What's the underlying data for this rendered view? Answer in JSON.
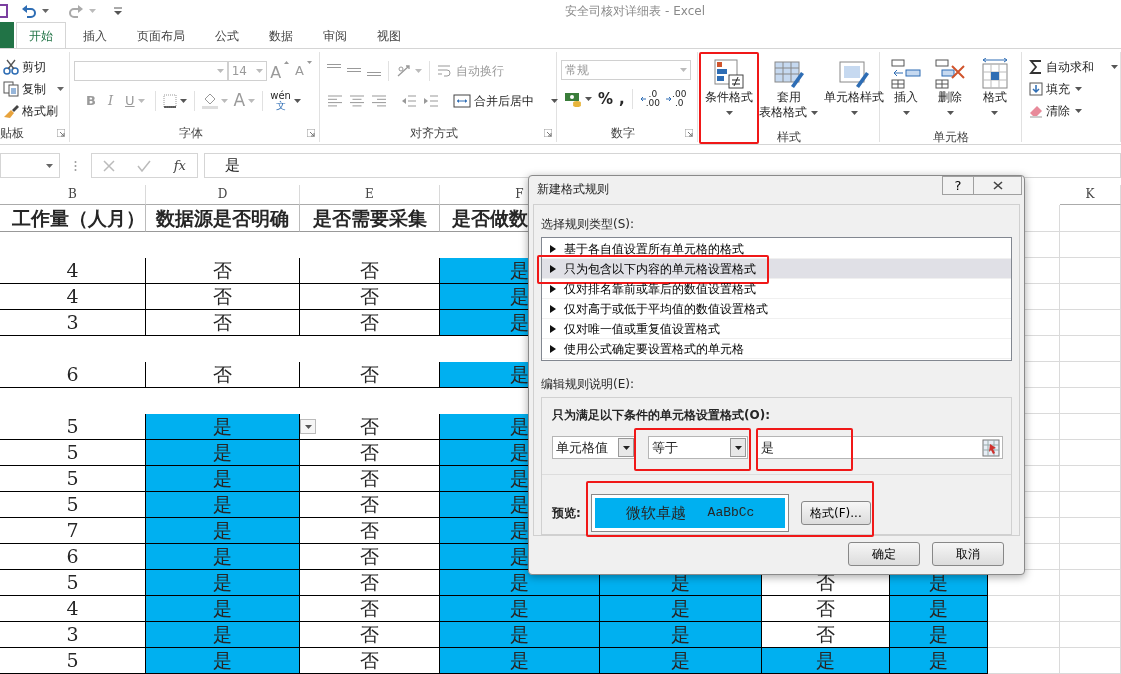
{
  "window": {
    "title": "安全司核对详细表 - Excel"
  },
  "tabs": [
    {
      "label": "开始",
      "selected": true
    },
    {
      "label": "插入",
      "selected": false
    },
    {
      "label": "页面布局",
      "selected": false
    },
    {
      "label": "公式",
      "selected": false
    },
    {
      "label": "数据",
      "selected": false
    },
    {
      "label": "审阅",
      "selected": false
    },
    {
      "label": "视图",
      "selected": false
    }
  ],
  "ribbon": {
    "groups": [
      {
        "kind": "clipboard",
        "label": "贴板",
        "buttons": [
          {
            "kind": "cut",
            "label": "剪切"
          },
          {
            "kind": "copy",
            "label": "复制"
          },
          {
            "kind": "brush",
            "label": "格式刷"
          }
        ]
      },
      {
        "kind": "font",
        "label": "字体",
        "font_size": "14",
        "grow": "A",
        "shrink": "A",
        "styles": [
          "B",
          "I",
          "U"
        ],
        "font_color": "A",
        "phonetic": [
          "wén",
          "文"
        ]
      },
      {
        "kind": "alignment",
        "label": "对齐方式",
        "buttons": [
          {
            "label": "自动换行",
            "disabled": true
          },
          {
            "label": "合并后居中",
            "disabled": false
          }
        ]
      },
      {
        "kind": "number",
        "label": "数字",
        "format": "常规",
        "symbols": [
          "%",
          ","
        ],
        "decimals": [
          [
            ".0",
            ".00"
          ],
          [
            ".00",
            ".0"
          ]
        ]
      },
      {
        "kind": "styles",
        "label": "样式",
        "buttons": [
          {
            "kind": "conditional",
            "lines": [
              "条件格式"
            ],
            "annotated": true
          },
          {
            "kind": "table",
            "lines": [
              "套用",
              "表格格式"
            ],
            "annotated": false
          },
          {
            "kind": "cellstyle",
            "lines": [
              "单元格样式"
            ],
            "annotated": false
          }
        ]
      },
      {
        "kind": "cells",
        "label": "单元格",
        "buttons": [
          {
            "kind": "insert",
            "label": "插入"
          },
          {
            "kind": "delete",
            "label": "删除"
          },
          {
            "kind": "format",
            "label": "格式"
          }
        ]
      },
      {
        "kind": "editing",
        "buttons": [
          {
            "kind": "sum",
            "label": "自动求和"
          },
          {
            "kind": "fill",
            "label": "填充"
          },
          {
            "kind": "clear",
            "label": "清除"
          }
        ]
      }
    ]
  },
  "formula_bar": {
    "function_label": "fx",
    "value": "是"
  },
  "sheet": {
    "columns": [
      {
        "label": "B"
      },
      {
        "label": "D"
      },
      {
        "label": "E"
      },
      {
        "label": "F"
      },
      null,
      null,
      null,
      null,
      {
        "label": "K"
      }
    ],
    "rows": [
      {
        "kind": "header",
        "cells": [
          {
            "text": "工作量（人月）"
          },
          {
            "text": "数据源是否明确"
          },
          {
            "text": "是否需要采集"
          },
          {
            "text": "是否做数"
          }
        ]
      },
      {
        "kind": "blank"
      },
      {
        "kind": "data",
        "cells": [
          {
            "text": "4",
            "filled": false
          },
          {
            "text": "否",
            "filled": false
          },
          {
            "text": "否",
            "filled": false
          },
          {
            "text": "是",
            "filled": true
          }
        ]
      },
      {
        "kind": "data",
        "cells": [
          {
            "text": "4",
            "filled": false
          },
          {
            "text": "否",
            "filled": false
          },
          {
            "text": "否",
            "filled": false
          },
          {
            "text": "是",
            "filled": true
          }
        ]
      },
      {
        "kind": "data",
        "cells": [
          {
            "text": "3",
            "filled": false
          },
          {
            "text": "否",
            "filled": false
          },
          {
            "text": "否",
            "filled": false
          },
          {
            "text": "是",
            "filled": true
          }
        ]
      },
      {
        "kind": "blank"
      },
      {
        "kind": "data",
        "cells": [
          {
            "text": "6",
            "filled": false
          },
          {
            "text": "否",
            "filled": false
          },
          {
            "text": "否",
            "filled": false
          },
          {
            "text": "是",
            "filled": true
          }
        ]
      },
      {
        "kind": "blank"
      },
      {
        "kind": "data",
        "cells": [
          {
            "text": "5",
            "filled": false
          },
          {
            "text": "是",
            "filled": true
          },
          {
            "text": "否",
            "filled": false,
            "dropdown": true
          },
          {
            "text": "是",
            "filled": true
          }
        ]
      },
      {
        "kind": "data",
        "cells": [
          {
            "text": "5",
            "filled": false
          },
          {
            "text": "是",
            "filled": true
          },
          {
            "text": "否",
            "filled": false
          },
          {
            "text": "是",
            "filled": true
          }
        ]
      },
      {
        "kind": "data",
        "cells": [
          {
            "text": "5",
            "filled": false
          },
          {
            "text": "是",
            "filled": true
          },
          {
            "text": "否",
            "filled": false
          },
          {
            "text": "是",
            "filled": true
          }
        ]
      },
      {
        "kind": "data",
        "cells": [
          {
            "text": "5",
            "filled": false
          },
          {
            "text": "是",
            "filled": true
          },
          {
            "text": "否",
            "filled": false
          },
          {
            "text": "是",
            "filled": true
          }
        ]
      },
      {
        "kind": "data",
        "cells": [
          {
            "text": "7",
            "filled": false
          },
          {
            "text": "是",
            "filled": true
          },
          {
            "text": "否",
            "filled": false
          },
          {
            "text": "是",
            "filled": true
          }
        ]
      },
      {
        "kind": "data",
        "cells": [
          {
            "text": "6",
            "filled": false
          },
          {
            "text": "是",
            "filled": true
          },
          {
            "text": "否",
            "filled": false
          },
          {
            "text": "是",
            "filled": true
          }
        ]
      },
      {
        "kind": "data",
        "cells": [
          {
            "text": "5",
            "filled": false
          },
          {
            "text": "是",
            "filled": true
          },
          {
            "text": "否",
            "filled": false
          },
          {
            "text": "是",
            "filled": true
          },
          {
            "text": "是",
            "filled": true
          },
          {
            "text": "否",
            "filled": false
          },
          {
            "text": "是",
            "filled": true
          }
        ]
      },
      {
        "kind": "data",
        "cells": [
          {
            "text": "4",
            "filled": false
          },
          {
            "text": "是",
            "filled": true
          },
          {
            "text": "否",
            "filled": false
          },
          {
            "text": "是",
            "filled": true
          },
          {
            "text": "是",
            "filled": true
          },
          {
            "text": "否",
            "filled": false
          },
          {
            "text": "是",
            "filled": true
          }
        ]
      },
      {
        "kind": "data",
        "cells": [
          {
            "text": "3",
            "filled": false
          },
          {
            "text": "是",
            "filled": true
          },
          {
            "text": "否",
            "filled": false
          },
          {
            "text": "是",
            "filled": true
          },
          {
            "text": "是",
            "filled": true
          },
          {
            "text": "否",
            "filled": false
          },
          {
            "text": "是",
            "filled": true
          }
        ]
      },
      {
        "kind": "data",
        "cells": [
          {
            "text": "5",
            "filled": false
          },
          {
            "text": "是",
            "filled": true
          },
          {
            "text": "否",
            "filled": false
          },
          {
            "text": "是",
            "filled": true
          },
          {
            "text": "是",
            "filled": true
          },
          {
            "text": "是",
            "filled": true
          },
          {
            "text": "是",
            "filled": true
          }
        ]
      }
    ]
  },
  "dialog": {
    "title": "新建格式规则",
    "help": "?",
    "type_label": "选择规则类型(S):",
    "rule_types": [
      {
        "label": "基于各自值设置所有单元格的格式",
        "selected": false,
        "annotated": false
      },
      {
        "label": "只为包含以下内容的单元格设置格式",
        "selected": true,
        "annotated": true
      },
      {
        "label": "仅对排名靠前或靠后的数值设置格式",
        "selected": false,
        "annotated": false
      },
      {
        "label": "仅对高于或低于平均值的数值设置格式",
        "selected": false,
        "annotated": false
      },
      {
        "label": "仅对唯一值或重复值设置格式",
        "selected": false,
        "annotated": false
      },
      {
        "label": "使用公式确定要设置格式的单元格",
        "selected": false,
        "annotated": false
      }
    ],
    "edit_label": "编辑规则说明(E):",
    "condition_label": "只为满足以下条件的单元格设置格式(O):",
    "condition": {
      "subject": {
        "value": "单元格值"
      },
      "operator": {
        "value": "等于",
        "annotated": true
      },
      "value": {
        "value": "是",
        "annotated": true
      }
    },
    "preview": {
      "label": "预览:",
      "sample": [
        "微软卓越",
        "AaBbCc"
      ],
      "annotated": true
    },
    "format_button": "格式(F)...",
    "buttons": [
      "确定",
      "取消"
    ]
  }
}
